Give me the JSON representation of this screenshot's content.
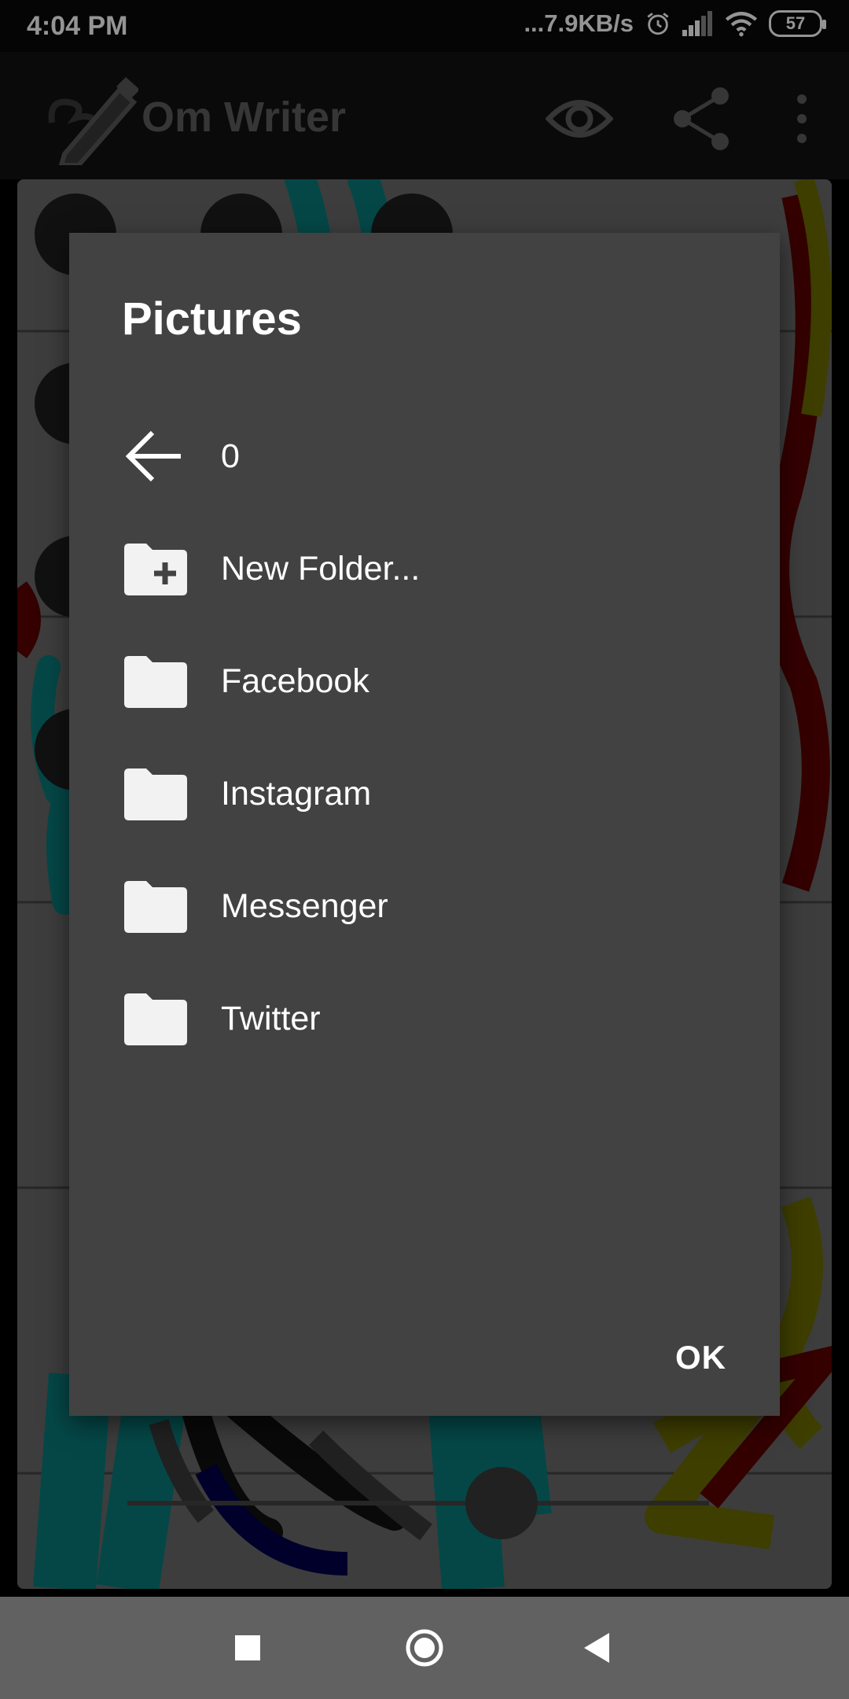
{
  "status_bar": {
    "time": "4:04 PM",
    "network_speed": "...7.9KB/s",
    "battery": "57",
    "icons": [
      "alarm-icon",
      "signal-icon",
      "wifi-icon",
      "battery-icon"
    ]
  },
  "app_bar": {
    "title": "Om Writer",
    "icons": [
      "om-pencil-logo-icon",
      "eye-icon",
      "share-icon",
      "more-vert-icon"
    ]
  },
  "dialog": {
    "title": "Pictures",
    "items": [
      {
        "label": "0",
        "icon": "arrow-back-icon"
      },
      {
        "label": "New Folder...",
        "icon": "folder-add-icon"
      },
      {
        "label": "Facebook",
        "icon": "folder-icon"
      },
      {
        "label": "Instagram",
        "icon": "folder-icon"
      },
      {
        "label": "Messenger",
        "icon": "folder-icon"
      },
      {
        "label": "Twitter",
        "icon": "folder-icon"
      }
    ],
    "ok_label": "OK"
  },
  "nav_bar": {
    "icons": [
      "recents-square-icon",
      "home-circle-icon",
      "back-triangle-icon"
    ]
  },
  "colors": {
    "dialog_bg": "#424242",
    "scrim": "rgba(0,0,0,0.42)",
    "nav_bg": "#616161",
    "app_bar_bg": "#121212"
  }
}
